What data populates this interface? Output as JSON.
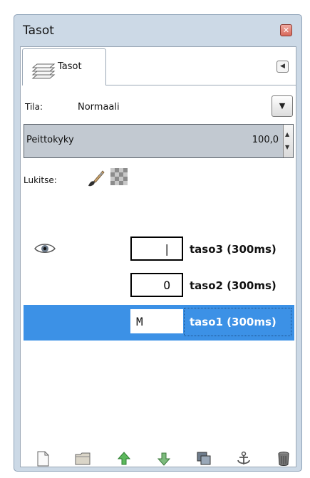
{
  "window": {
    "title": "Tasot",
    "close_icon": "close-icon"
  },
  "tab": {
    "label": "Tasot",
    "icon": "layers-icon"
  },
  "mode": {
    "label": "Tila:",
    "value": "Normaali"
  },
  "opacity": {
    "label": "Peittokyky",
    "value": "100,0"
  },
  "lock": {
    "label": "Lukitse:"
  },
  "layers": [
    {
      "name": "taso3 (300ms)",
      "thumb": "|",
      "visible": true,
      "selected": false
    },
    {
      "name": "taso2 (300ms)",
      "thumb": "O",
      "visible": false,
      "selected": false
    },
    {
      "name": "taso1 (300ms)",
      "thumb": "M",
      "visible": false,
      "selected": true
    }
  ],
  "colors": {
    "selection": "#3c91e6",
    "window_bg": "#ccd9e6",
    "panel_bg": "#ffffff"
  },
  "toolbar_icons": [
    "new-layer-icon",
    "new-group-icon",
    "raise-layer-icon",
    "lower-layer-icon",
    "duplicate-layer-icon",
    "anchor-icon",
    "delete-layer-icon"
  ]
}
